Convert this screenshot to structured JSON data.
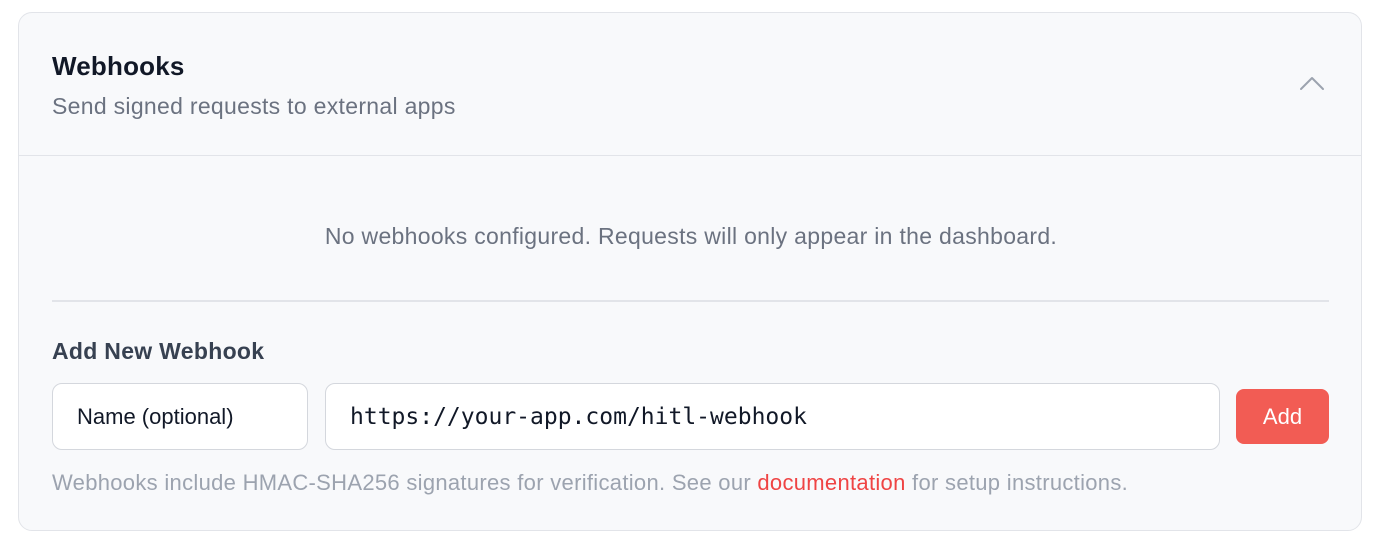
{
  "panel": {
    "title": "Webhooks",
    "subtitle": "Send signed requests to external apps",
    "collapse_icon": "chevron-up-icon"
  },
  "empty_state": {
    "message": "No webhooks configured. Requests will only appear in the dashboard."
  },
  "add_form": {
    "title": "Add New Webhook",
    "name_placeholder": "Name (optional)",
    "url_value": "https://your-app.com/hitl-webhook",
    "add_label": "Add",
    "helper_before": "Webhooks include HMAC-SHA256 signatures for verification. See our ",
    "helper_link": "documentation",
    "helper_after": " for setup instructions."
  },
  "colors": {
    "accent": "#f25c54",
    "link": "#ef4444"
  }
}
